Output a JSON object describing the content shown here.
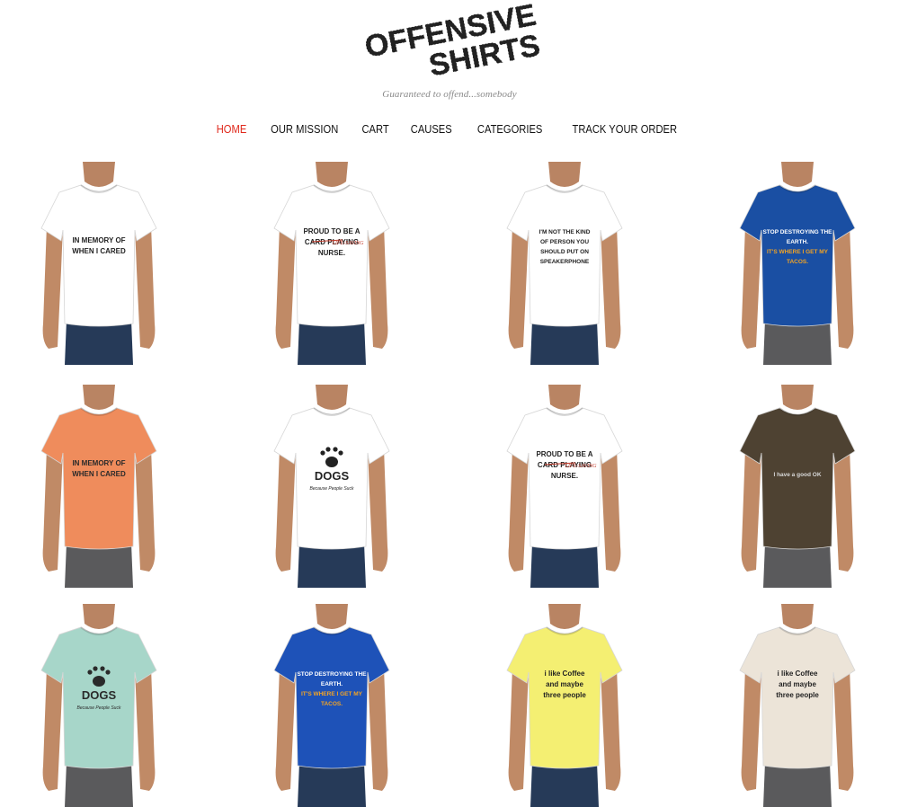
{
  "logo": {
    "line1": "OFFENSIVE",
    "line2": "SHIRTS"
  },
  "tagline": "Guaranteed to offend...somebody",
  "nav": [
    {
      "label": "HOME",
      "active": true
    },
    {
      "label": "OUR MISSION"
    },
    {
      "label": "CART"
    },
    {
      "label": "CAUSES"
    },
    {
      "label": "CATEGORIES"
    },
    {
      "label": "TRACK YOUR ORDER"
    }
  ],
  "colors": {
    "accent": "#e0281b",
    "text": "#111111",
    "tagline": "#8a8a8a"
  },
  "products": [
    {
      "shirt_color": "#ffffff",
      "text_color": "#222222",
      "lines": [
        "IN MEMORY OF",
        "WHEN I CARED"
      ]
    },
    {
      "shirt_color": "#ffffff",
      "text_color": "#222222",
      "lines": [
        "PROUD TO BE A",
        "CARD PLAYING",
        "NURSE."
      ],
      "scribble": "LIFE-SAVING"
    },
    {
      "shirt_color": "#ffffff",
      "text_color": "#222222",
      "lines": [
        "I'M NOT THE KIND",
        "OF PERSON YOU",
        "SHOULD PUT ON",
        "SPEAKERPHONE"
      ]
    },
    {
      "shirt_color": "#1a4fa3",
      "text_color": "#ffffff",
      "lines": [
        "STOP DESTROYING THE",
        "EARTH.",
        "IT'S WHERE I GET MY",
        "TACOS."
      ]
    },
    {
      "shirt_color": "#ef8c5c",
      "text_color": "#2a2a2a",
      "lines": [
        "IN MEMORY OF",
        "WHEN I CARED"
      ]
    },
    {
      "shirt_color": "#ffffff",
      "text_color": "#222222",
      "lines": [
        "DOGS",
        "Because People Suck"
      ],
      "icon": "paw-icon"
    },
    {
      "shirt_color": "#ffffff",
      "text_color": "#222222",
      "lines": [
        "PROUD TO BE A",
        "CARD PLAYING",
        "NURSE."
      ],
      "scribble": "LIFE-SAVING"
    },
    {
      "shirt_color": "#4e4232",
      "text_color": "#d8d8d8",
      "lines": [
        "I have a good OK"
      ]
    },
    {
      "shirt_color": "#a7d6c9",
      "text_color": "#2a2a2a",
      "lines": [
        "DOGS",
        "Because People Suck"
      ],
      "icon": "paw-icon"
    },
    {
      "shirt_color": "#1e52b8",
      "text_color": "#ffffff",
      "lines": [
        "STOP DESTROYING THE",
        "EARTH.",
        "IT'S WHERE I GET MY",
        "TACOS."
      ]
    },
    {
      "shirt_color": "#f4ef72",
      "text_color": "#222222",
      "lines": [
        "i like Coffee",
        "and maybe",
        "three people"
      ]
    },
    {
      "shirt_color": "#ece4d8",
      "text_color": "#222222",
      "lines": [
        "i like Coffee",
        "and maybe",
        "three people"
      ]
    }
  ]
}
